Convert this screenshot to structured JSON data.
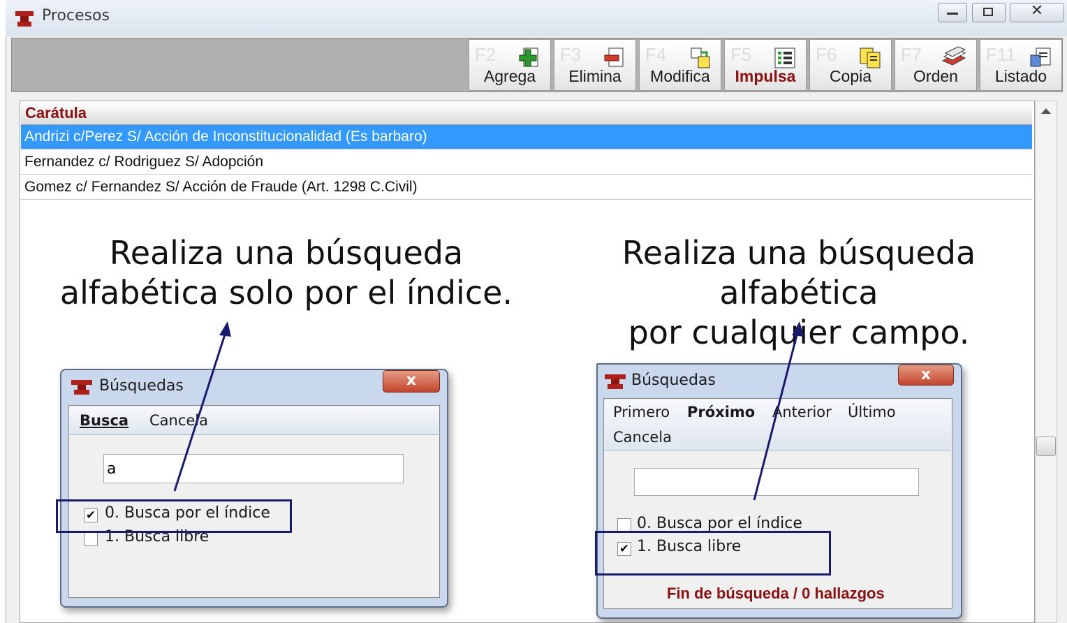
{
  "window": {
    "title": "Procesos"
  },
  "toolbar": {
    "buttons": [
      {
        "key": "F2",
        "label": "Agrega",
        "icon": "add-doc-icon"
      },
      {
        "key": "F3",
        "label": "Elimina",
        "icon": "remove-doc-icon"
      },
      {
        "key": "F4",
        "label": "Modifica",
        "icon": "edit-doc-icon"
      },
      {
        "key": "F5",
        "label": "Impulsa",
        "icon": "list-icon"
      },
      {
        "key": "F6",
        "label": "Copia",
        "icon": "copy-icon"
      },
      {
        "key": "F7",
        "label": "Orden",
        "icon": "stack-icon"
      },
      {
        "key": "F11",
        "label": "Listado",
        "icon": "report-icon"
      }
    ]
  },
  "grid": {
    "header": "Carátula",
    "rows": [
      "Andrizi c/Perez S/ Acción de Inconstitucionalidad (Es barbaro)",
      "Fernandez c/ Rodriguez S/ Adopción",
      "Gomez c/ Fernandez S/ Acción de Fraude (Art. 1298 C.Civil)"
    ]
  },
  "captions": {
    "left_line1": "Realiza una búsqueda",
    "left_line2": "alfabética solo por el índice.",
    "right_line1": "Realiza una búsqueda alfabética",
    "right_line2": "por cualquier campo."
  },
  "dialog_left": {
    "title": "Búsquedas",
    "close": "x",
    "menu": [
      "Busca",
      "Cancela"
    ],
    "input_value": "a",
    "options": [
      {
        "label": "0. Busca por el índice",
        "checked": true
      },
      {
        "label": "1. Busca libre",
        "checked": false
      }
    ]
  },
  "dialog_right": {
    "title": "Búsquedas",
    "close": "x",
    "menu": [
      "Primero",
      "Próximo",
      "Anterior",
      "Último",
      "Cancela"
    ],
    "input_value": "",
    "options": [
      {
        "label": "0. Busca por el índice",
        "checked": false
      },
      {
        "label": "1. Busca libre",
        "checked": true
      }
    ],
    "status": "Fin de búsqueda / 0 hallazgos"
  },
  "colors": {
    "accent_dark_red": "#8b1010",
    "selection_blue": "#3399ff",
    "annotation_navy": "#1a1a6e"
  }
}
